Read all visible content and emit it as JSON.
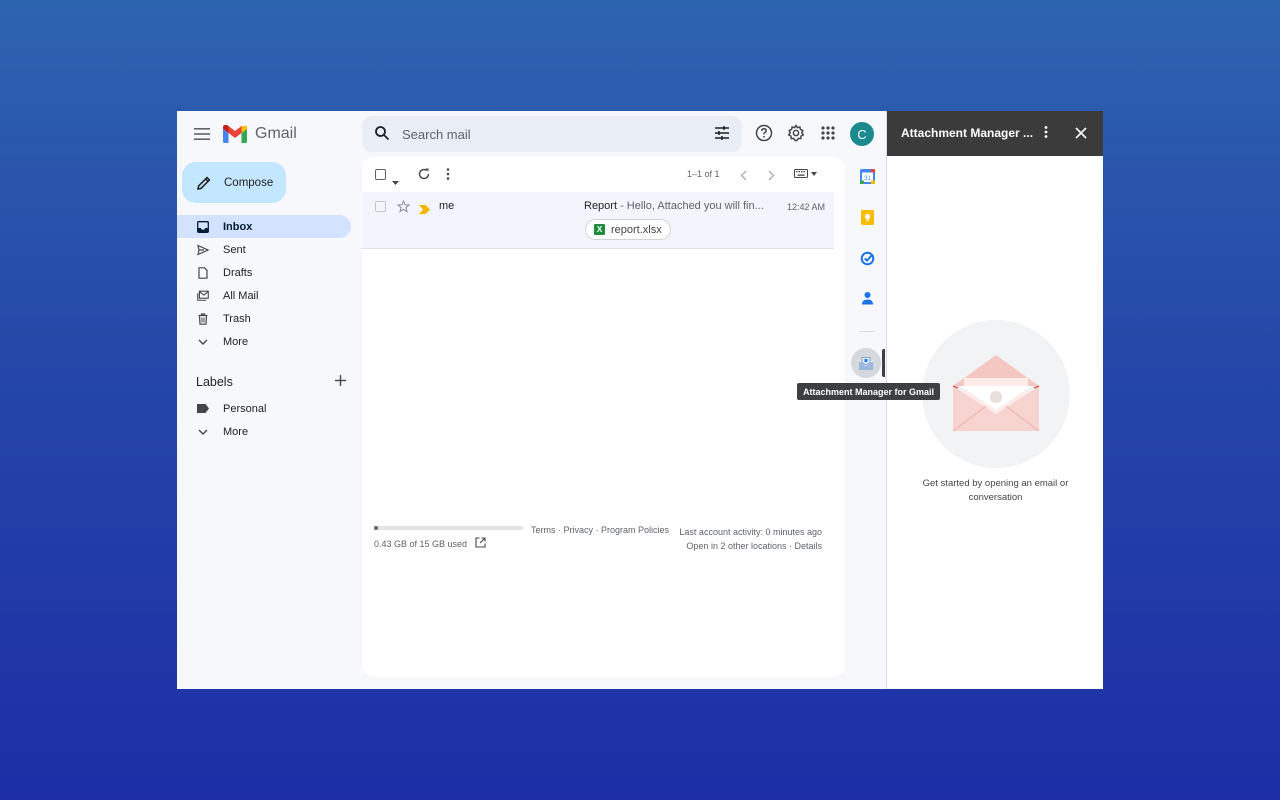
{
  "app": {
    "logo_text": "Gmail"
  },
  "search": {
    "placeholder": "Search mail"
  },
  "account": {
    "avatar_letter": "C",
    "avatar_color": "#1b8a8f"
  },
  "compose": {
    "label": "Compose"
  },
  "nav": {
    "items": [
      {
        "label": "Inbox",
        "icon": "inbox-icon",
        "active": true
      },
      {
        "label": "Sent",
        "icon": "send-icon"
      },
      {
        "label": "Drafts",
        "icon": "draft-icon"
      },
      {
        "label": "All Mail",
        "icon": "all-mail-icon"
      },
      {
        "label": "Trash",
        "icon": "trash-icon"
      },
      {
        "label": "More",
        "icon": "chevron-down-icon"
      }
    ]
  },
  "labels": {
    "title": "Labels",
    "items": [
      {
        "label": "Personal",
        "icon": "label-icon"
      },
      {
        "label": "More",
        "icon": "chevron-down-icon"
      }
    ]
  },
  "toolbar": {
    "count": "1–1 of 1"
  },
  "messages": [
    {
      "sender": "me",
      "subject": "Report",
      "snippet": " - Hello, Attached you will fin...",
      "time": "12:42 AM",
      "attachment": "report.xlsx"
    }
  ],
  "footer": {
    "storage_text": "0.43 GB of 15 GB used",
    "storage_fraction": 0.03,
    "links": "Terms · Privacy · Program Policies",
    "activity": "Last account activity: 0 minutes ago",
    "locations": "Open in 2 other locations · Details"
  },
  "rail": {
    "tooltip": "Attachment Manager for Gmail",
    "apps": [
      "calendar-icon",
      "keep-icon",
      "tasks-icon",
      "contacts-icon",
      "attachment-manager-icon"
    ]
  },
  "addon": {
    "title": "Attachment Manager ...",
    "message": "Get started by opening an email or conversation"
  }
}
